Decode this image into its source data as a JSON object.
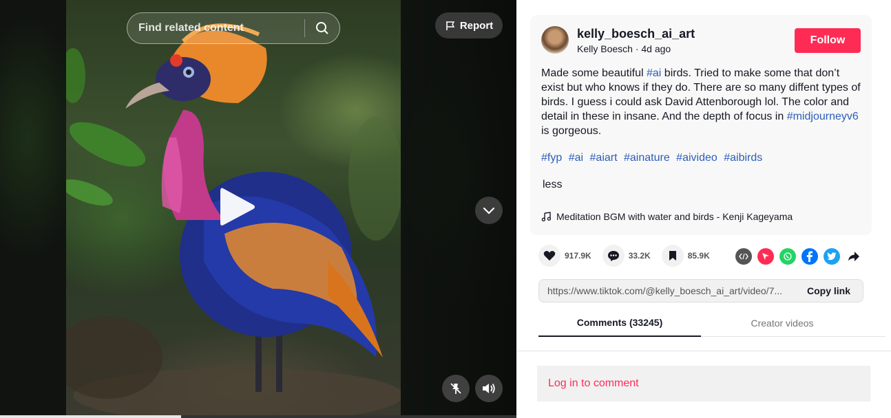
{
  "video": {
    "search_placeholder": "Find related content",
    "report_label": "Report",
    "progress_fraction": 0.35
  },
  "post": {
    "username": "kelly_boesch_ai_art",
    "display_name": "Kelly Boesch",
    "time_ago": "4d ago",
    "follow_label": "Follow",
    "description": {
      "part1": "Made some beautiful ",
      "tag1": "#ai",
      "part2": " birds. Tried to make some that don’t exist but who knows if they do. There are so many diffent types of birds. I guess i could ask David Attenborough lol. The color and detail in these in insane. And the depth of focus in ",
      "tag2": "#midjourneyv6",
      "part3": " is gorgeous."
    },
    "hashtags": [
      "#fyp",
      "#ai",
      "#aiart",
      "#ainature",
      "#aivideo",
      "#aibirds"
    ],
    "less_label": "less",
    "music": "Meditation BGM with water and birds - Kenji Kageyama"
  },
  "stats": {
    "likes": "917.9K",
    "comments": "33.2K",
    "saves": "85.9K"
  },
  "share": {
    "icons": [
      "embed-icon",
      "send-icon",
      "whatsapp-icon",
      "facebook-icon",
      "twitter-icon",
      "share-arrow-icon"
    ],
    "colors": {
      "send": "#fe2c55",
      "whatsapp": "#25d366",
      "facebook": "#0075fa",
      "twitter": "#1da1f2",
      "embed": "#555555"
    }
  },
  "link": {
    "url": "https://www.tiktok.com/@kelly_boesch_ai_art/video/7...",
    "copy_label": "Copy link"
  },
  "tabs": {
    "comments": "Comments (33245)",
    "creator_videos": "Creator videos"
  },
  "login": {
    "label": "Log in to comment"
  },
  "colors": {
    "accent": "#fe2c55",
    "hashtag": "#2b5db9"
  }
}
